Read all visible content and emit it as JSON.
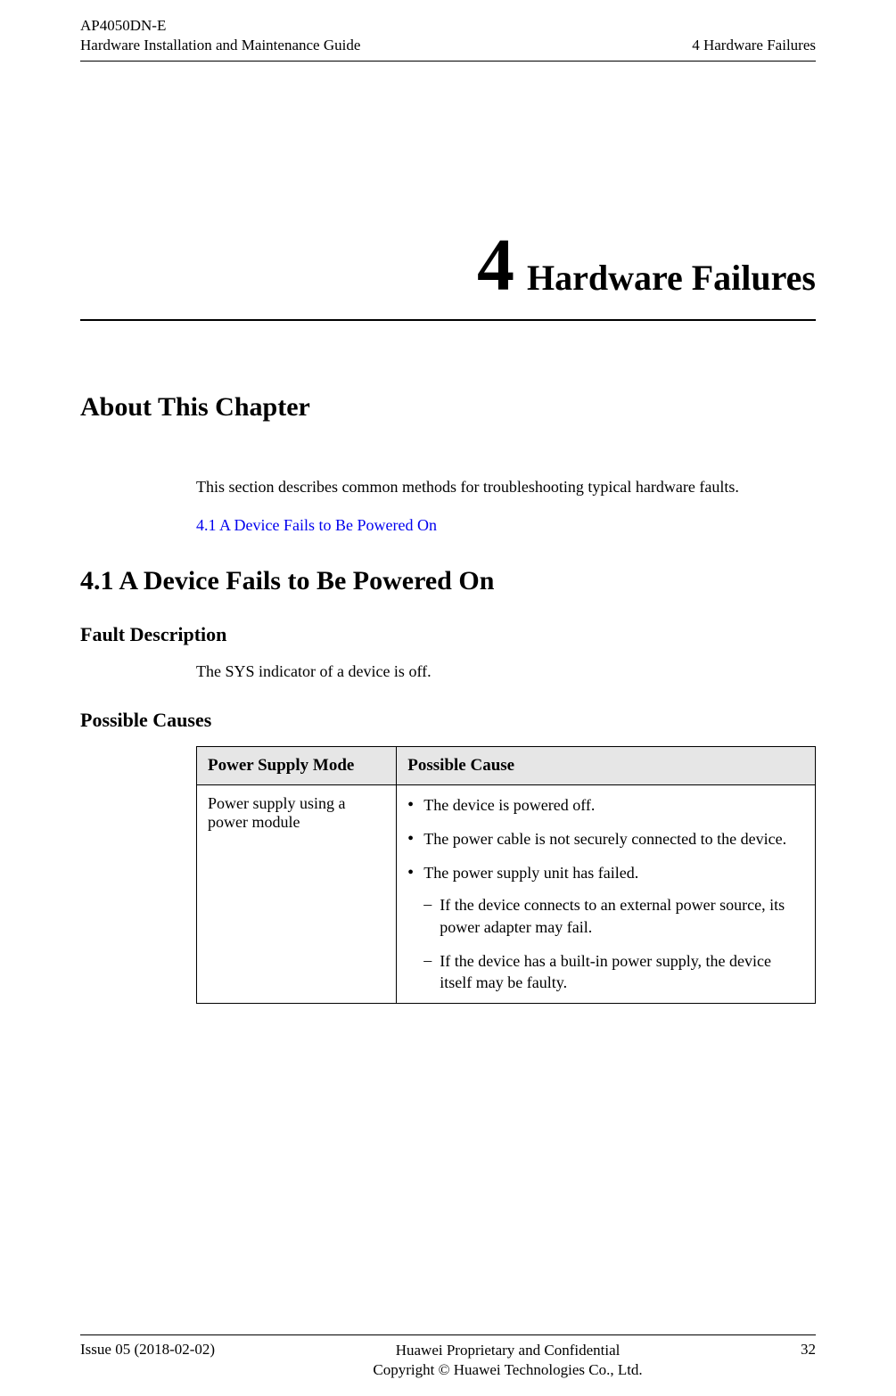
{
  "header": {
    "product": "AP4050DN-E",
    "guide": "Hardware Installation and Maintenance Guide",
    "section": "4 Hardware Failures"
  },
  "chapter": {
    "number": "4",
    "title": "Hardware Failures"
  },
  "about": {
    "heading": "About This Chapter",
    "text": "This section describes common methods for troubleshooting typical hardware faults.",
    "link": "4.1 A Device Fails to Be Powered On"
  },
  "section41": {
    "heading": "4.1 A Device Fails to Be Powered On",
    "fault_heading": "Fault Description",
    "fault_text": "The SYS indicator of a device is off.",
    "causes_heading": "Possible Causes"
  },
  "table": {
    "col1": "Power Supply Mode",
    "col2": "Possible Cause",
    "row1_mode": "Power supply using a power module",
    "row1_causes": {
      "c1": "The device is powered off.",
      "c2": "The power cable is not securely connected to the device.",
      "c3": "The power supply unit has failed.",
      "c3a": "If the device connects to an external power source, its power adapter may fail.",
      "c3b": "If the device has a built-in power supply, the device itself may be faulty."
    }
  },
  "footer": {
    "issue": "Issue 05 (2018-02-02)",
    "confidential": "Huawei Proprietary and Confidential",
    "copyright": "Copyright © Huawei Technologies Co., Ltd.",
    "page": "32"
  }
}
